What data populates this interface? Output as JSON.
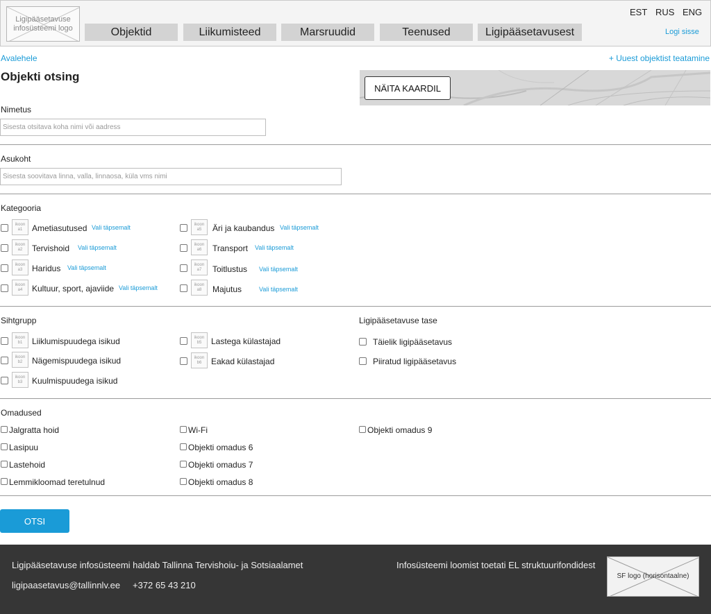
{
  "header": {
    "logo_text": "Ligipääsetavuse infosüsteemi logo",
    "nav": [
      "Objektid",
      "Liikumisteed",
      "Marsruudid",
      "Teenused",
      "Ligipääsetavusest"
    ],
    "languages": [
      "EST",
      "RUS",
      "ENG"
    ],
    "login": "Logi sisse"
  },
  "breadcrumb": "Avalehele",
  "report_link": "+ Uuest objektist teatamine",
  "page_title": "Objekti otsing",
  "map": {
    "button": "NÄITA KAARDIL"
  },
  "name_section": {
    "label": "Nimetus",
    "placeholder": "Sisesta otsitava koha nimi või aadress"
  },
  "location_section": {
    "label": "Asukoht",
    "placeholder": "Sisesta soovitava linna, valla, linnaosa, küla vms nimi"
  },
  "category": {
    "label": "Kategooria",
    "refine": "Vali täpsemalt",
    "items": [
      {
        "icon": "ikoon a1",
        "label": "Ametiasutused"
      },
      {
        "icon": "ikoon a2",
        "label": "Tervishoid"
      },
      {
        "icon": "ikoon a3",
        "label": "Haridus"
      },
      {
        "icon": "ikoon a4",
        "label": "Kultuur, sport, ajaviide"
      },
      {
        "icon": "ikoon a5",
        "label": "Äri ja kaubandus"
      },
      {
        "icon": "ikoon a6",
        "label": "Transport"
      },
      {
        "icon": "ikoon a7",
        "label": "Toitlustus"
      },
      {
        "icon": "ikoon a8",
        "label": "Majutus"
      }
    ]
  },
  "target_group": {
    "label": "Sihtgrupp",
    "items": [
      {
        "icon": "ikoon b1",
        "label": "Liiklumispuudega isikud"
      },
      {
        "icon": "ikoon b2",
        "label": "Nägemispuudega isikud"
      },
      {
        "icon": "ikoon b3",
        "label": "Kuulmispuudega isikud"
      },
      {
        "icon": "ikoon b5",
        "label": "Lastega külastajad"
      },
      {
        "icon": "ikoon b6",
        "label": "Eakad külastajad"
      }
    ]
  },
  "accessibility_level": {
    "label": "Ligipääsetavuse tase",
    "items": [
      "Täielik ligipääsetavus",
      "Piiratud ligipääsetavus"
    ]
  },
  "properties": {
    "label": "Omadused",
    "items": [
      "Jalgratta hoid",
      "Lasipuu",
      "Lastehoid",
      "Lemmikloomad teretulnud",
      "Wi-Fi",
      "Objekti omadus 6",
      "Objekti  omadus 7",
      "Objekti  omadus 8",
      "Objekti  omadus 9"
    ]
  },
  "search_button": "OTSI",
  "footer": {
    "maintainer": "Ligipääsetavuse infosüsteemi haldab Tallinna Tervishoiu- ja Sotsiaalamet",
    "email": "ligipaasetavus@tallinnlv.ee",
    "phone": "+372 65 43 210",
    "funding": "Infosüsteemi loomist toetati EL struktuurifondidest",
    "sf_logo": "SF logo (horisontaalne)"
  },
  "colors": {
    "accent": "#1a9bd7",
    "footer_bg": "#363636",
    "nav_bg": "#d3d3d3"
  }
}
